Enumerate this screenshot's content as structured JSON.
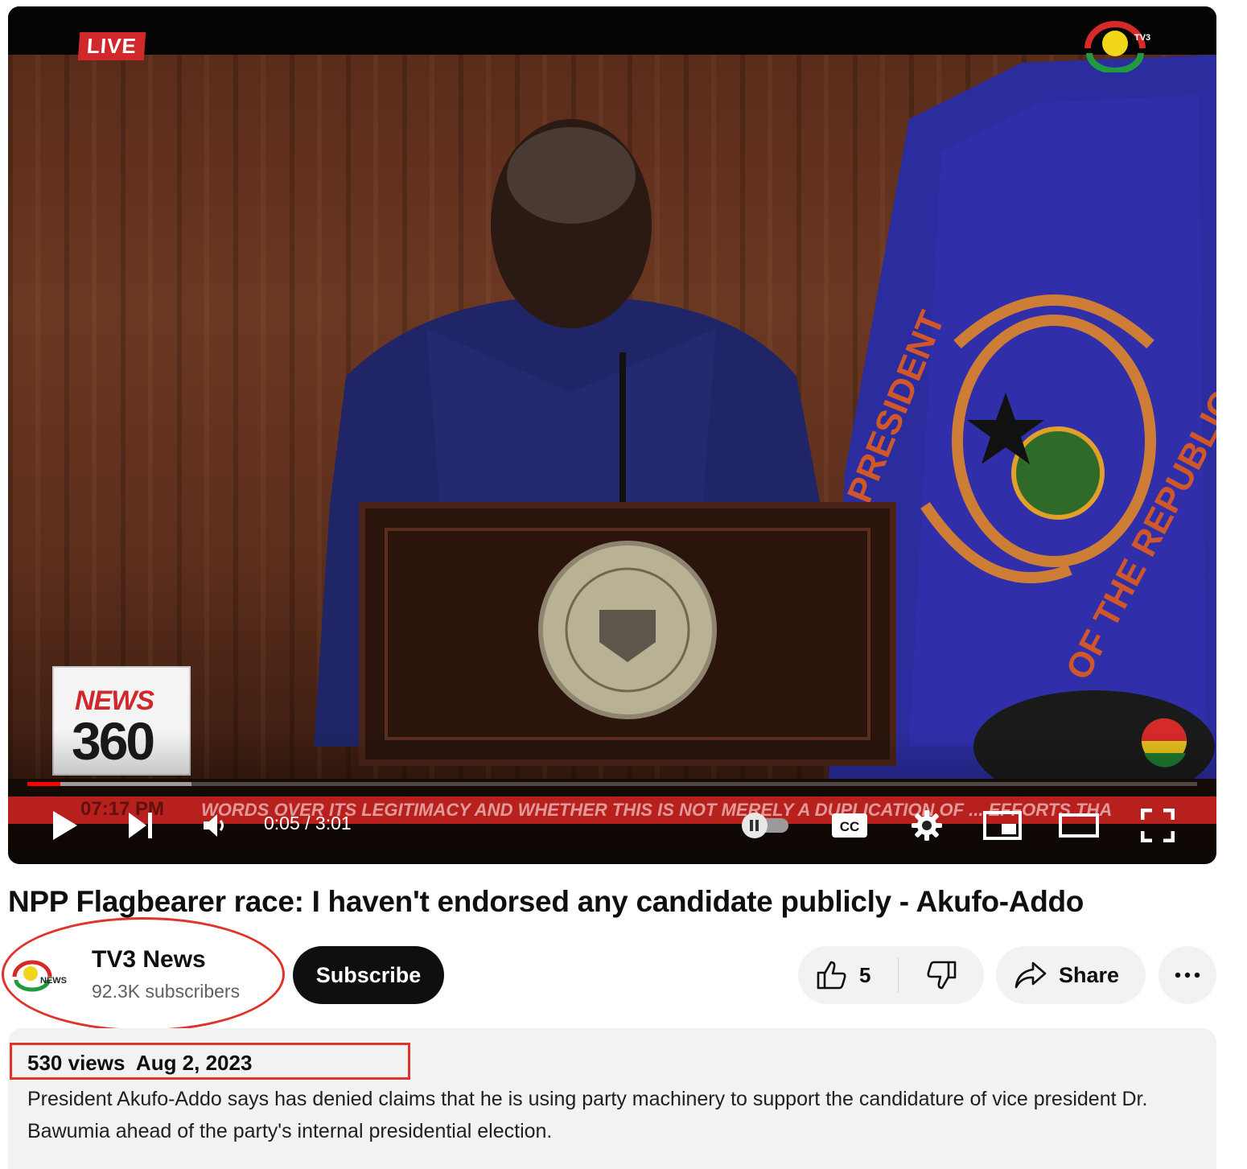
{
  "player": {
    "live_badge": "LIVE",
    "overlay_news_line1": "NEWS",
    "overlay_news_line2": "360",
    "ticker_time": "07:17 PM",
    "ticker_text": "WORDS OVER ITS LEGITIMACY AND WHETHER THIS IS NOT MERELY A DUPLICATION OF ... EFFORTS THA",
    "timecode": "0:05 / 3:01",
    "progress": {
      "played_fraction": 0.028,
      "loaded_fraction": 0.14
    },
    "icons": [
      "play-icon",
      "next-icon",
      "volume-icon",
      "autoplay-toggle-icon",
      "captions-icon",
      "settings-icon",
      "miniplayer-icon",
      "theater-icon",
      "fullscreen-icon"
    ],
    "captions_label": "CC",
    "accent_color": "#ff0000"
  },
  "video": {
    "title": "NPP Flagbearer race: I haven't endorsed any candidate publicly - Akufo-Addo"
  },
  "channel": {
    "name": "TV3 News",
    "subscribers": "92.3K subscribers",
    "avatar_text": "NEWS"
  },
  "actions": {
    "subscribe_label": "Subscribe",
    "like_count": "5",
    "share_label": "Share",
    "more_label": "···"
  },
  "description": {
    "meta": "530 views  Aug 2, 2023",
    "text": "President Akufo-Addo says has denied claims that he is using party machinery to support the candidature of vice president Dr. Bawumia ahead of the party's internal presidential election."
  },
  "annotations": {
    "color": "#e0332a"
  }
}
